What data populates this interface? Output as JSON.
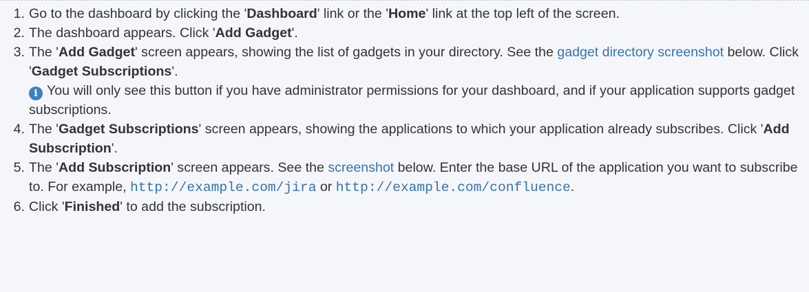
{
  "steps": [
    {
      "num": "1.",
      "t1": "Go to the dashboard by clicking the '",
      "b1": "Dashboard",
      "t2": "' link or the '",
      "b2": "Home",
      "t3": "' link at the top left of the screen."
    },
    {
      "num": "2.",
      "t1": "The dashboard appears. Click '",
      "b1": "Add Gadget",
      "t2": "'."
    },
    {
      "num": "3.",
      "t1": "The '",
      "b1": "Add Gadget",
      "t2": "' screen appears, showing the list of gadgets in your directory. See the ",
      "link": "gadget directory screenshot",
      "t3": " below. Click '",
      "b2": "Gadget Subscriptions",
      "t4": "'.",
      "note_icon": "info-icon",
      "note": "You will only see this button if you have administrator permissions for your dashboard, and if your application supports gadget subscriptions."
    },
    {
      "num": "4.",
      "t1": "The '",
      "b1": "Gadget Subscriptions",
      "t2": "' screen appears, showing the applications to which your application already subscribes. Click '",
      "b2": "Add Subscription",
      "t3": "'."
    },
    {
      "num": "5.",
      "t1": "The '",
      "b1": "Add Subscription",
      "t2": "' screen appears. See the ",
      "link": "screenshot",
      "t3": " below. Enter the base URL of the application you want to subscribe to. For example, ",
      "code1": "http://example.com/jira",
      "t4": " or ",
      "code2": "http://example.com/confluence",
      "t5": "."
    },
    {
      "num": "6.",
      "t1": "Click '",
      "b1": "Finished",
      "t2": "' to add the subscription."
    }
  ],
  "colors": {
    "link": "#3572b0",
    "text": "#333333",
    "background": "#f4f6f9",
    "info_icon": "#3b7fc4"
  }
}
